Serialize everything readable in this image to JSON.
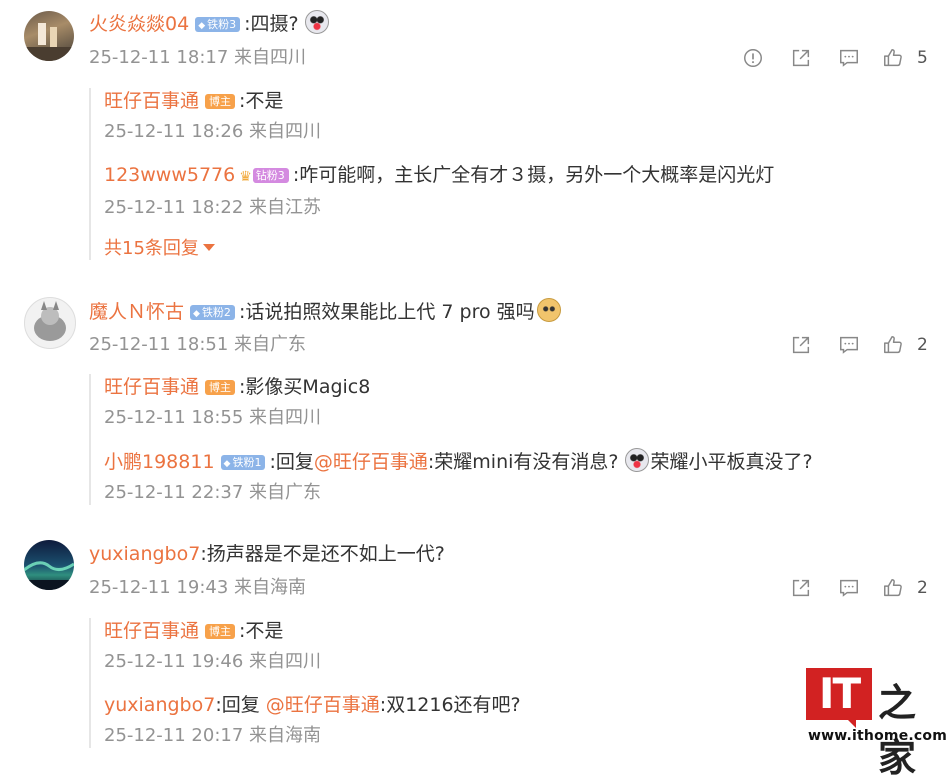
{
  "comments": [
    {
      "user": "火炎焱燚04",
      "badge": "铁粉3",
      "text": "四摄?",
      "time": "25-12-11 18:17 来自四川",
      "likes": "5",
      "has_report": true,
      "replies": [
        {
          "user": "旺仔百事通",
          "badge": "博主",
          "text": "不是",
          "time": "25-12-11 18:26 来自四川"
        },
        {
          "user": "123www5776",
          "badge": "钻粉3",
          "text": "咋可能啊，主长广全有才３摄，另外一个大概率是闪光灯",
          "time": "25-12-11 18:22 来自江苏"
        }
      ],
      "more_replies": "共15条回复"
    },
    {
      "user": "魔人Ｎ怀古",
      "badge": "铁粉2",
      "text": "话说拍照效果能比上代 7 pro 强吗",
      "time": "25-12-11 18:51 来自广东",
      "likes": "2",
      "replies": [
        {
          "user": "旺仔百事通",
          "badge": "博主",
          "text": "影像买Magic8",
          "time": "25-12-11 18:55 来自四川"
        },
        {
          "user": "小鹏198811",
          "badge": "铁粉1",
          "reply_prefix": "回复",
          "mention": "@旺仔百事通",
          "text": "荣耀mini有没有消息?",
          "text2": "荣耀小平板真没了?",
          "time": "25-12-11 22:37 来自广东"
        }
      ]
    },
    {
      "user": "yuxiangbo7",
      "text": "扬声器是不是还不如上一代?",
      "time": "25-12-11 19:43 来自海南",
      "likes": "2",
      "replies": [
        {
          "user": "旺仔百事通",
          "badge": "博主",
          "text": "不是",
          "time": "25-12-11 19:46 来自四川"
        },
        {
          "user": "yuxiangbo7",
          "reply_prefix": "回复 ",
          "mention": "@旺仔百事通",
          "text": "双1216还有吧?",
          "time": "25-12-11 20:17 来自海南"
        }
      ]
    }
  ],
  "icons": {
    "report": "report-icon",
    "share": "share-icon",
    "comment": "comment-icon",
    "like": "thumbs-up-icon"
  },
  "colors": {
    "username": "#eb7340",
    "meta": "#939393",
    "badge_iron": "#8cb4e8",
    "badge_host": "#f7a14a",
    "logo_red": "#d22222"
  },
  "logo": {
    "mark": "IT",
    "cn": "之家",
    "url": "www.ithome.com"
  }
}
